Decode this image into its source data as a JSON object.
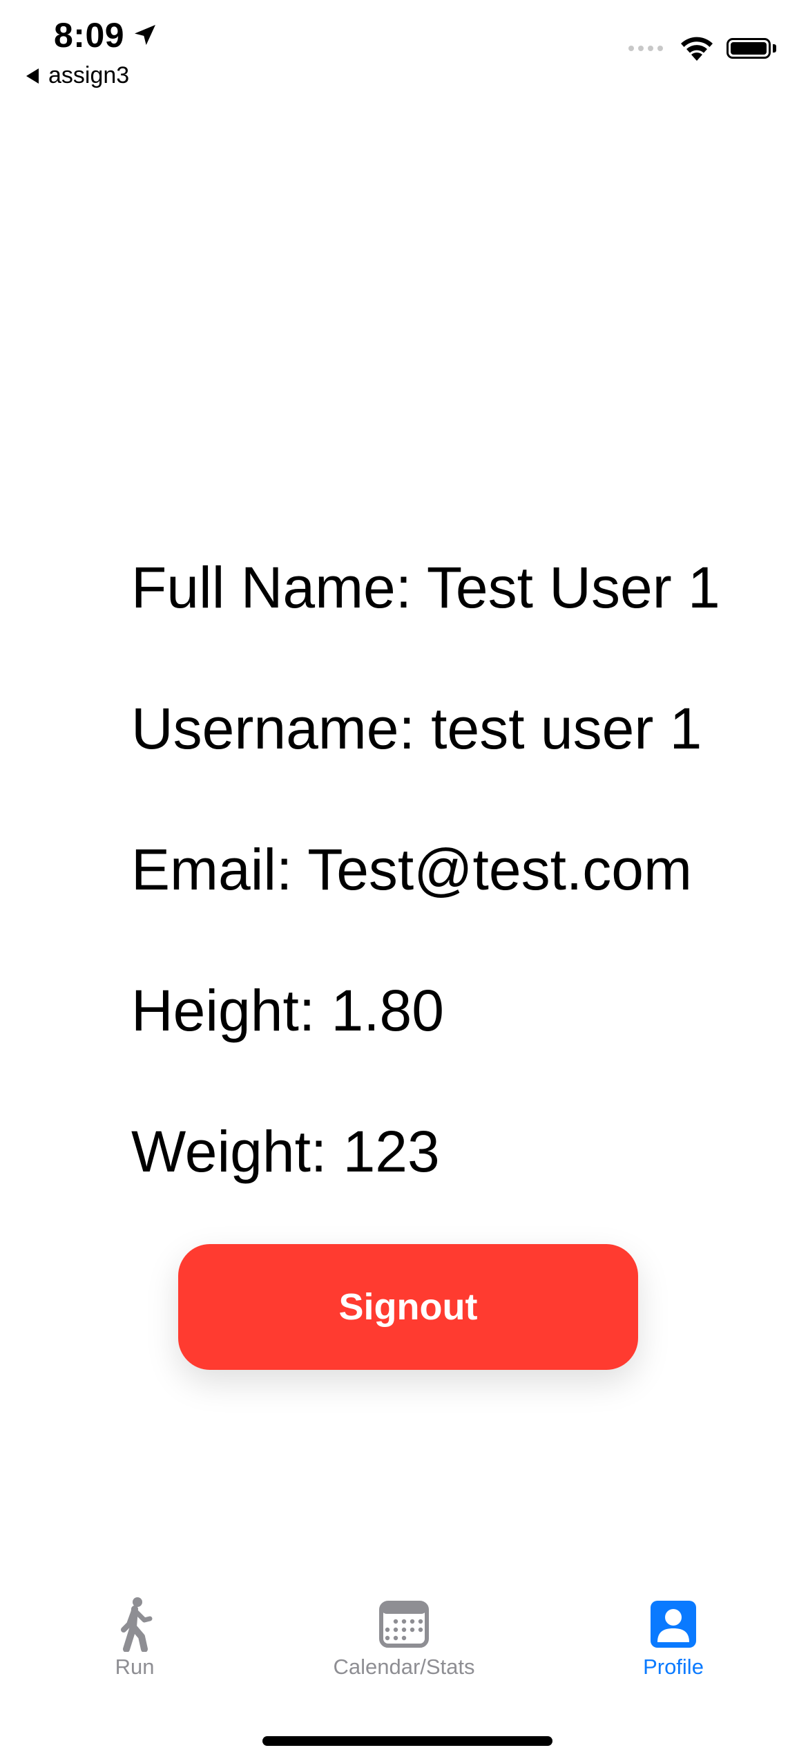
{
  "status_bar": {
    "time": "8:09",
    "back_label": "assign3"
  },
  "profile": {
    "full_name_line": "Full Name: Test User 1",
    "username_line": "Username: test user 1",
    "email_line": "Email: Test@test.com",
    "height_line": "Height: 1.80",
    "weight_line": "Weight: 123"
  },
  "signout_button": {
    "label": "Signout",
    "color": "#ff3b30"
  },
  "tab_bar": {
    "tabs": [
      {
        "label": "Run",
        "icon": "walking-figure-icon",
        "active": false
      },
      {
        "label": "Calendar/Stats",
        "icon": "calendar-icon",
        "active": false
      },
      {
        "label": "Profile",
        "icon": "person-card-icon",
        "active": true
      }
    ],
    "active_color": "#0a7aff",
    "inactive_color": "#8e8e93"
  }
}
